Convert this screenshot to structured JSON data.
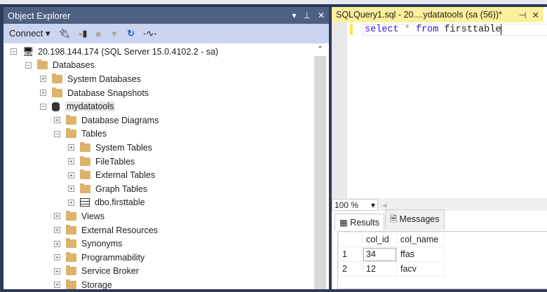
{
  "object_explorer": {
    "title": "Object Explorer",
    "connect_label": "Connect",
    "tree": [
      {
        "label": "20.198.144.174 (SQL Server 15.0.4102.2 - sa)",
        "level": 0,
        "toggle": "−",
        "icon": "server-icon"
      },
      {
        "label": "Databases",
        "level": 1,
        "toggle": "−",
        "icon": "folder-icon"
      },
      {
        "label": "System Databases",
        "level": 2,
        "toggle": "+",
        "icon": "folder-icon"
      },
      {
        "label": "Database Snapshots",
        "level": 2,
        "toggle": "+",
        "icon": "folder-icon"
      },
      {
        "label": "mydatatools",
        "level": 2,
        "toggle": "−",
        "icon": "database-icon",
        "selected": true
      },
      {
        "label": "Database Diagrams",
        "level": 3,
        "toggle": "+",
        "icon": "folder-icon"
      },
      {
        "label": "Tables",
        "level": 3,
        "toggle": "−",
        "icon": "folder-icon"
      },
      {
        "label": "System Tables",
        "level": 4,
        "toggle": "+",
        "icon": "folder-icon"
      },
      {
        "label": "FileTables",
        "level": 4,
        "toggle": "+",
        "icon": "folder-icon"
      },
      {
        "label": "External Tables",
        "level": 4,
        "toggle": "+",
        "icon": "folder-icon"
      },
      {
        "label": "Graph Tables",
        "level": 4,
        "toggle": "+",
        "icon": "folder-icon"
      },
      {
        "label": "dbo.firsttable",
        "level": 4,
        "toggle": "+",
        "icon": "table-icon"
      },
      {
        "label": "Views",
        "level": 3,
        "toggle": "+",
        "icon": "folder-icon"
      },
      {
        "label": "External Resources",
        "level": 3,
        "toggle": "+",
        "icon": "folder-icon"
      },
      {
        "label": "Synonyms",
        "level": 3,
        "toggle": "+",
        "icon": "folder-icon"
      },
      {
        "label": "Programmability",
        "level": 3,
        "toggle": "+",
        "icon": "folder-icon"
      },
      {
        "label": "Service Broker",
        "level": 3,
        "toggle": "+",
        "icon": "folder-icon"
      },
      {
        "label": "Storage",
        "level": 3,
        "toggle": "+",
        "icon": "folder-icon"
      }
    ]
  },
  "query": {
    "tab_title": "SQLQuery1.sql - 20....ydatatools (sa (56))*",
    "code": {
      "k1": "select",
      "op": "*",
      "k2": "from",
      "ident": "firsttable"
    },
    "zoom": "100 %",
    "result_tabs": [
      "Results",
      "Messages"
    ],
    "columns": [
      "col_id",
      "col_name"
    ],
    "rows": [
      [
        "1",
        "34",
        "ffas"
      ],
      [
        "2",
        "12",
        "facv"
      ]
    ]
  }
}
